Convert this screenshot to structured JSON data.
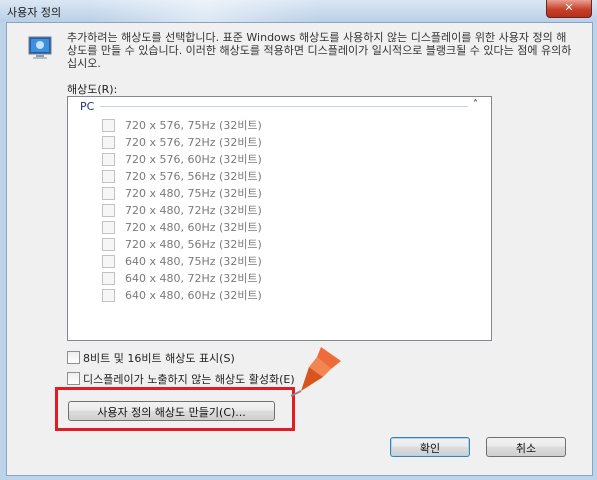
{
  "window": {
    "title": "사용자 정의",
    "close_glyph": "✕"
  },
  "description": "추가하려는 해상도를 선택합니다. 표준 Windows 해상도를 사용하지 않는 디스플레이를 위한 사용자 정의 해상도를 만들 수 있습니다. 이러한 해상도를 적용하면 디스플레이가 일시적으로 블랭크될 수 있다는 점에 유의하십시오.",
  "resolution_label": "해상도(R):",
  "group": {
    "name": "PC",
    "chevron": "˄"
  },
  "resolutions": [
    "720 x 576, 75Hz (32비트)",
    "720 x 576, 72Hz (32비트)",
    "720 x 576, 60Hz (32비트)",
    "720 x 576, 56Hz (32비트)",
    "720 x 480, 75Hz (32비트)",
    "720 x 480, 72Hz (32비트)",
    "720 x 480, 60Hz (32비트)",
    "720 x 480, 56Hz (32비트)",
    "640 x 480, 75Hz (32비트)",
    "640 x 480, 72Hz (32비트)",
    "640 x 480, 60Hz (32비트)"
  ],
  "options": {
    "show_8_16bit": "8비트 및 16비트 해상도 표시(S)",
    "enable_unexposed": "디스플레이가 노출하지 않는 해상도 활성화(E)"
  },
  "buttons": {
    "create_custom": "사용자 정의 해상도 만들기(C)...",
    "ok": "확인",
    "cancel": "취소"
  },
  "colors": {
    "highlight": "#e31b23",
    "pin": "#ef6b3a"
  }
}
